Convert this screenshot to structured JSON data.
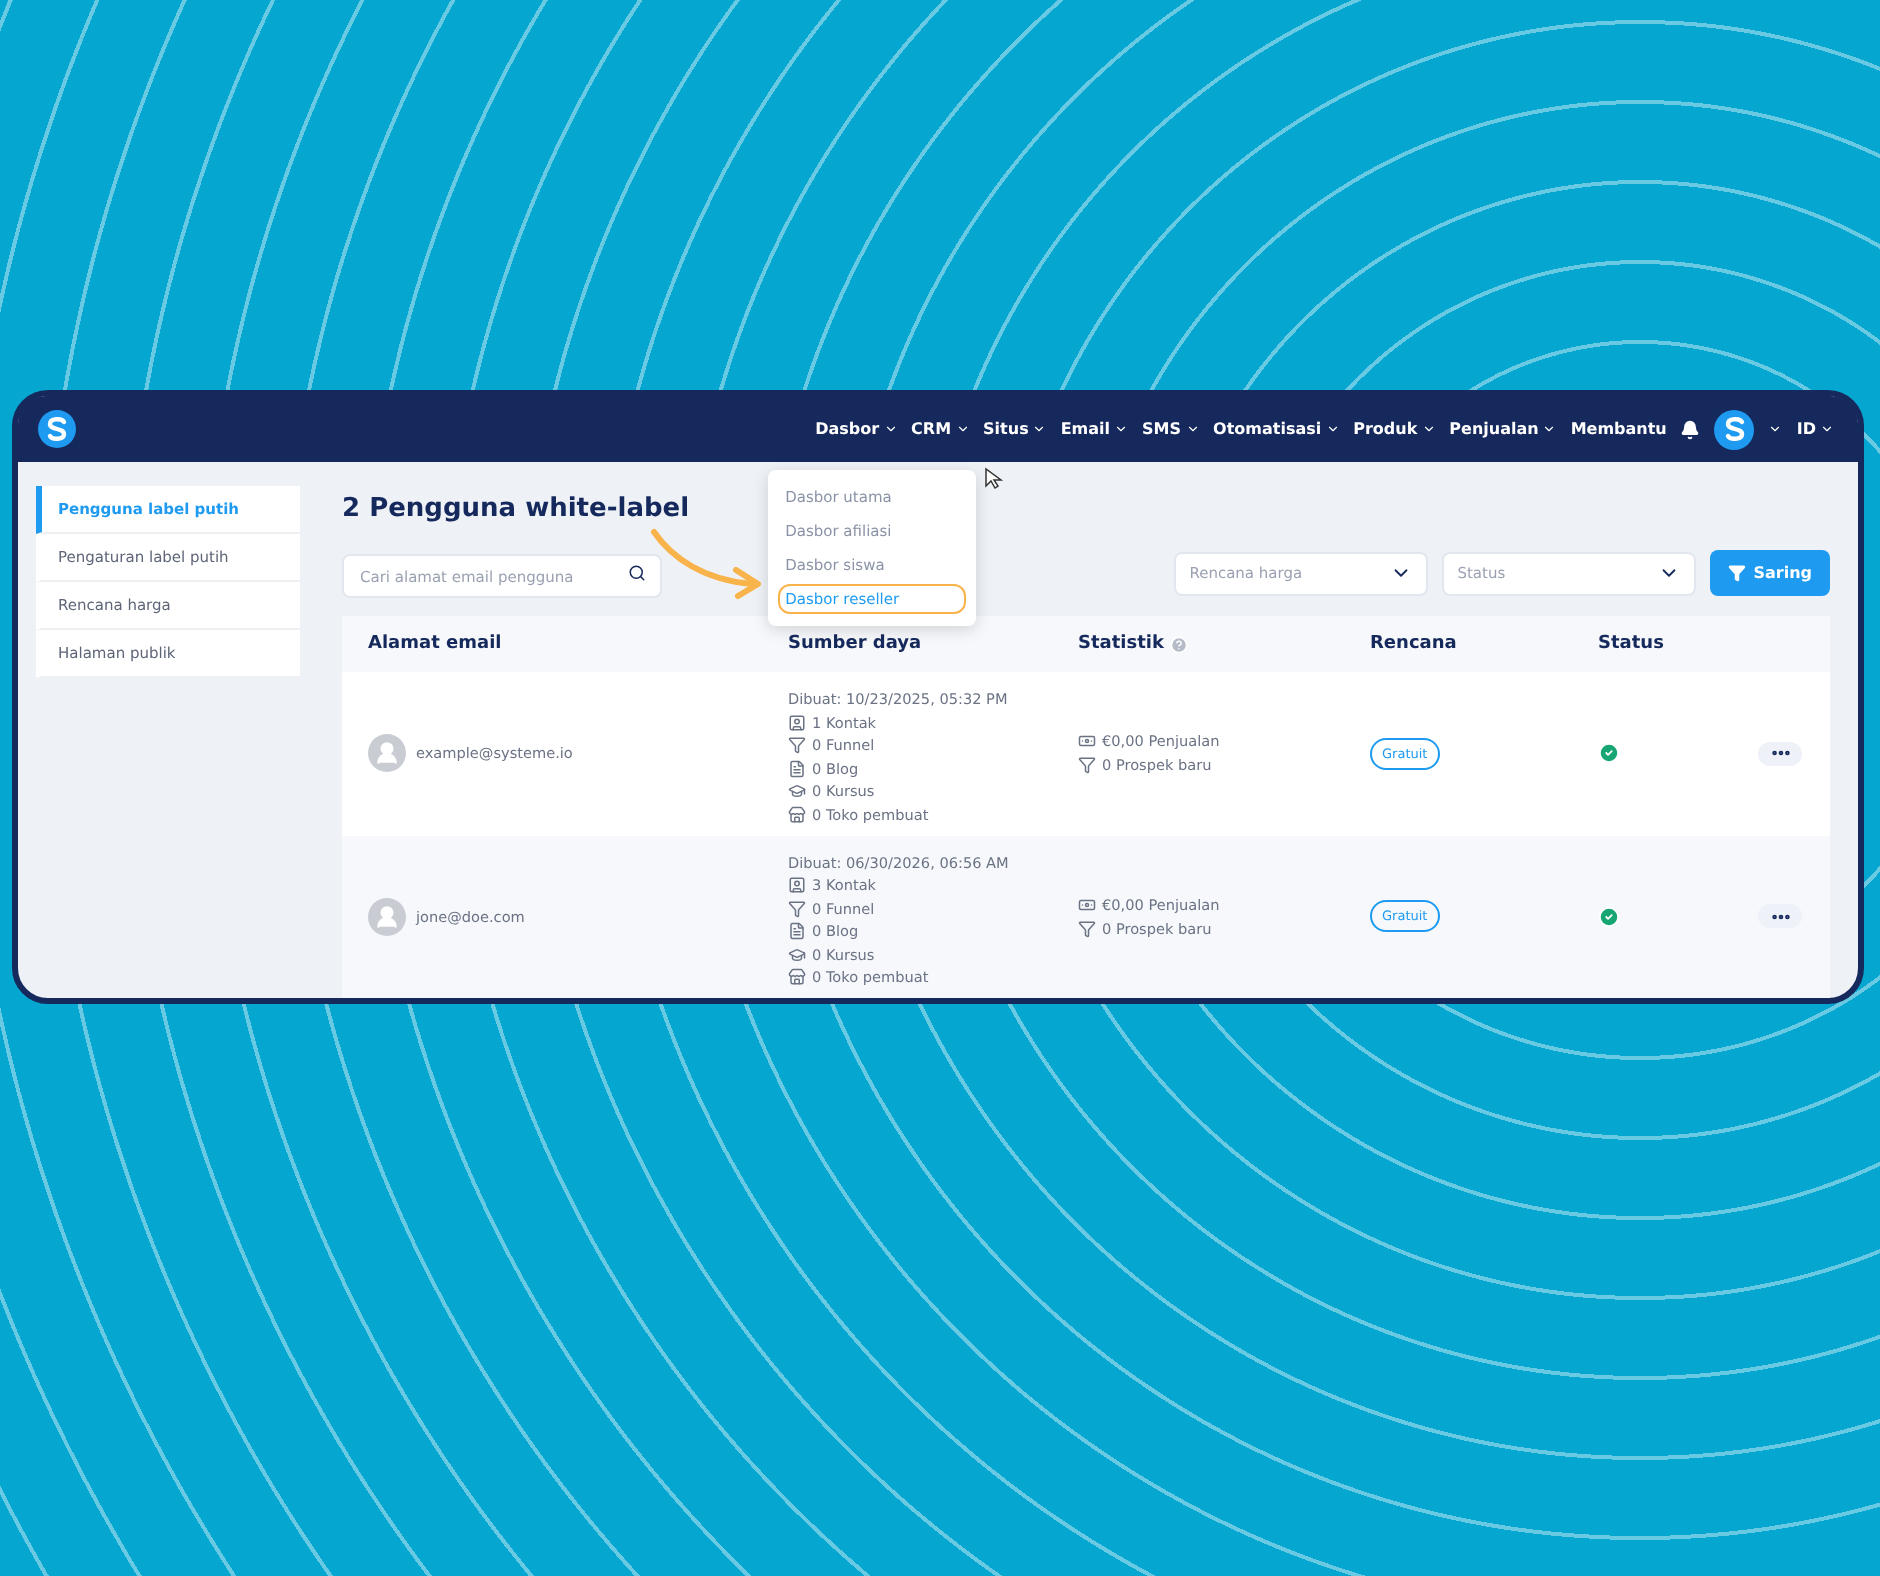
{
  "nav": {
    "items": [
      {
        "label": "Dasbor",
        "dropdown": true,
        "menu": [
          {
            "label": "Dasbor utama",
            "highlighted": false
          },
          {
            "label": "Dasbor afiliasi",
            "highlighted": false
          },
          {
            "label": "Dasbor siswa",
            "highlighted": false
          },
          {
            "label": "Dasbor reseller",
            "highlighted": true
          }
        ]
      },
      {
        "label": "CRM",
        "dropdown": true
      },
      {
        "label": "Situs",
        "dropdown": true
      },
      {
        "label": "Email",
        "dropdown": true
      },
      {
        "label": "SMS",
        "dropdown": true
      },
      {
        "label": "Otomatisasi",
        "dropdown": true
      },
      {
        "label": "Produk",
        "dropdown": true
      },
      {
        "label": "Penjualan",
        "dropdown": true
      },
      {
        "label": "Membantu",
        "dropdown": false
      }
    ],
    "language": "ID"
  },
  "sidebar": {
    "items": [
      {
        "label": "Pengguna label putih",
        "selected": true
      },
      {
        "label": "Pengaturan label putih",
        "selected": false
      },
      {
        "label": "Rencana harga",
        "selected": false
      },
      {
        "label": "Halaman publik",
        "selected": false
      }
    ]
  },
  "title": "2 Pengguna white-label",
  "search": {
    "placeholder": "Cari alamat email pengguna"
  },
  "filters": [
    {
      "placeholder": "Rencana harga"
    },
    {
      "placeholder": "Status"
    }
  ],
  "filter_button": "Saring",
  "table": {
    "columns": [
      {
        "label": "Alamat email",
        "kind": "plain"
      },
      {
        "label": "Sumber daya",
        "kind": "plain"
      },
      {
        "label": "Statistik",
        "kind": "with-info"
      },
      {
        "label": "Rencana",
        "kind": "plain"
      },
      {
        "label": "Status",
        "kind": "plain"
      }
    ],
    "rows": [
      {
        "email": "example@systeme.io",
        "created": "Dibuat: 10/23/2025, 05:32 PM",
        "resources": [
          {
            "kind": "contact",
            "text": "1 Kontak"
          },
          {
            "kind": "funnel",
            "text": "0 Funnel"
          },
          {
            "kind": "blog",
            "text": "0 Blog"
          },
          {
            "kind": "course",
            "text": "0 Kursus"
          },
          {
            "kind": "store",
            "text": "0 Toko pembuat"
          }
        ],
        "stats": [
          {
            "kind": "money",
            "text": "€0,00 Penjualan"
          },
          {
            "kind": "funnel",
            "text": "0 Prospek baru"
          }
        ],
        "plan": "Gratuit",
        "active": true
      },
      {
        "email": "jone@doe.com",
        "created": "Dibuat: 06/30/2026, 06:56 AM",
        "resources": [
          {
            "kind": "contact",
            "text": "3 Kontak"
          },
          {
            "kind": "funnel",
            "text": "0 Funnel"
          },
          {
            "kind": "blog",
            "text": "0 Blog"
          },
          {
            "kind": "course",
            "text": "0 Kursus"
          },
          {
            "kind": "store",
            "text": "0 Toko pembuat"
          }
        ],
        "stats": [
          {
            "kind": "money",
            "text": "€0,00 Penjualan"
          },
          {
            "kind": "funnel",
            "text": "0 Prospek baru"
          }
        ],
        "plan": "Gratuit",
        "active": true
      }
    ]
  }
}
